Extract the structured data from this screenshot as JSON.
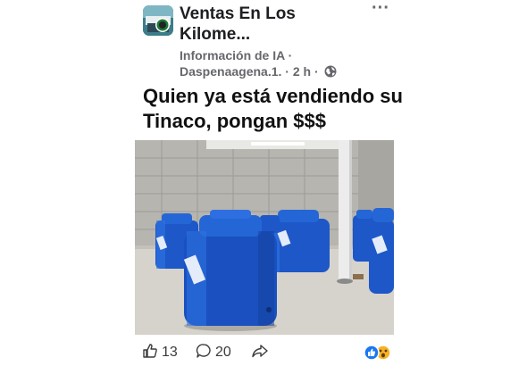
{
  "post": {
    "group_name": "Ventas En Los Kilome...",
    "meta_line1": "Información de IA ·",
    "meta_user": "Daspenaagena.1.",
    "meta_time": " · 2 h ·",
    "text": "Quien ya está vendiendo su Tinaco, pongan $$$",
    "more_label": "···"
  },
  "actions": {
    "likes": "13",
    "comments": "20"
  },
  "colors": {
    "accent_blue": "#1877f2",
    "tank_blue": "#1f5fd0",
    "meta_gray": "#65676b"
  },
  "icons": [
    "globe-icon",
    "like-icon",
    "comment-icon",
    "share-icon",
    "like-reaction-icon",
    "wow-reaction-icon",
    "more-icon"
  ]
}
